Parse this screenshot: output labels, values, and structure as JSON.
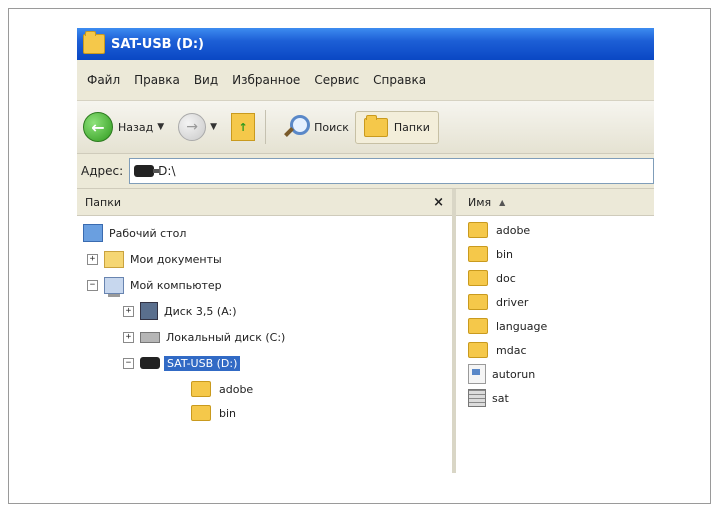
{
  "window": {
    "title": "SAT-USB (D:)"
  },
  "menu": {
    "items": [
      "Файл",
      "Правка",
      "Вид",
      "Избранное",
      "Сервис",
      "Справка"
    ]
  },
  "toolbar": {
    "back_label": "Назад",
    "search_label": "Поиск",
    "folders_label": "Папки"
  },
  "address": {
    "label": "Адрес:",
    "value": "D:\\"
  },
  "folders_panel": {
    "title": "Папки",
    "close": "×",
    "tree": [
      {
        "label": "Рабочий стол",
        "icon": "desktop-icon"
      },
      {
        "label": "Мои документы",
        "icon": "documents-icon"
      },
      {
        "label": "Мой компьютер",
        "icon": "computer-icon"
      },
      {
        "label": "Диск 3,5 (A:)",
        "icon": "floppy-icon"
      },
      {
        "label": "Локальный диск (C:)",
        "icon": "hard-drive-icon"
      },
      {
        "label": "SAT-USB (D:)",
        "icon": "usb-drive-icon",
        "selected": true
      },
      {
        "label": "adobe",
        "icon": "folder-icon"
      },
      {
        "label": "bin",
        "icon": "folder-icon"
      }
    ]
  },
  "file_list": {
    "column_header": "Имя",
    "items": [
      {
        "label": "adobe",
        "icon": "folder-icon"
      },
      {
        "label": "bin",
        "icon": "folder-icon"
      },
      {
        "label": "doc",
        "icon": "folder-icon"
      },
      {
        "label": "driver",
        "icon": "folder-icon"
      },
      {
        "label": "language",
        "icon": "folder-icon"
      },
      {
        "label": "mdac",
        "icon": "folder-icon"
      },
      {
        "label": "autorun",
        "icon": "file-icon"
      },
      {
        "label": "sat",
        "icon": "file-icon"
      }
    ]
  },
  "colors": {
    "titlebar": "#1d5fd6",
    "selection": "#316ac5",
    "folder": "#f5c84a",
    "chrome": "#ece9d8"
  }
}
